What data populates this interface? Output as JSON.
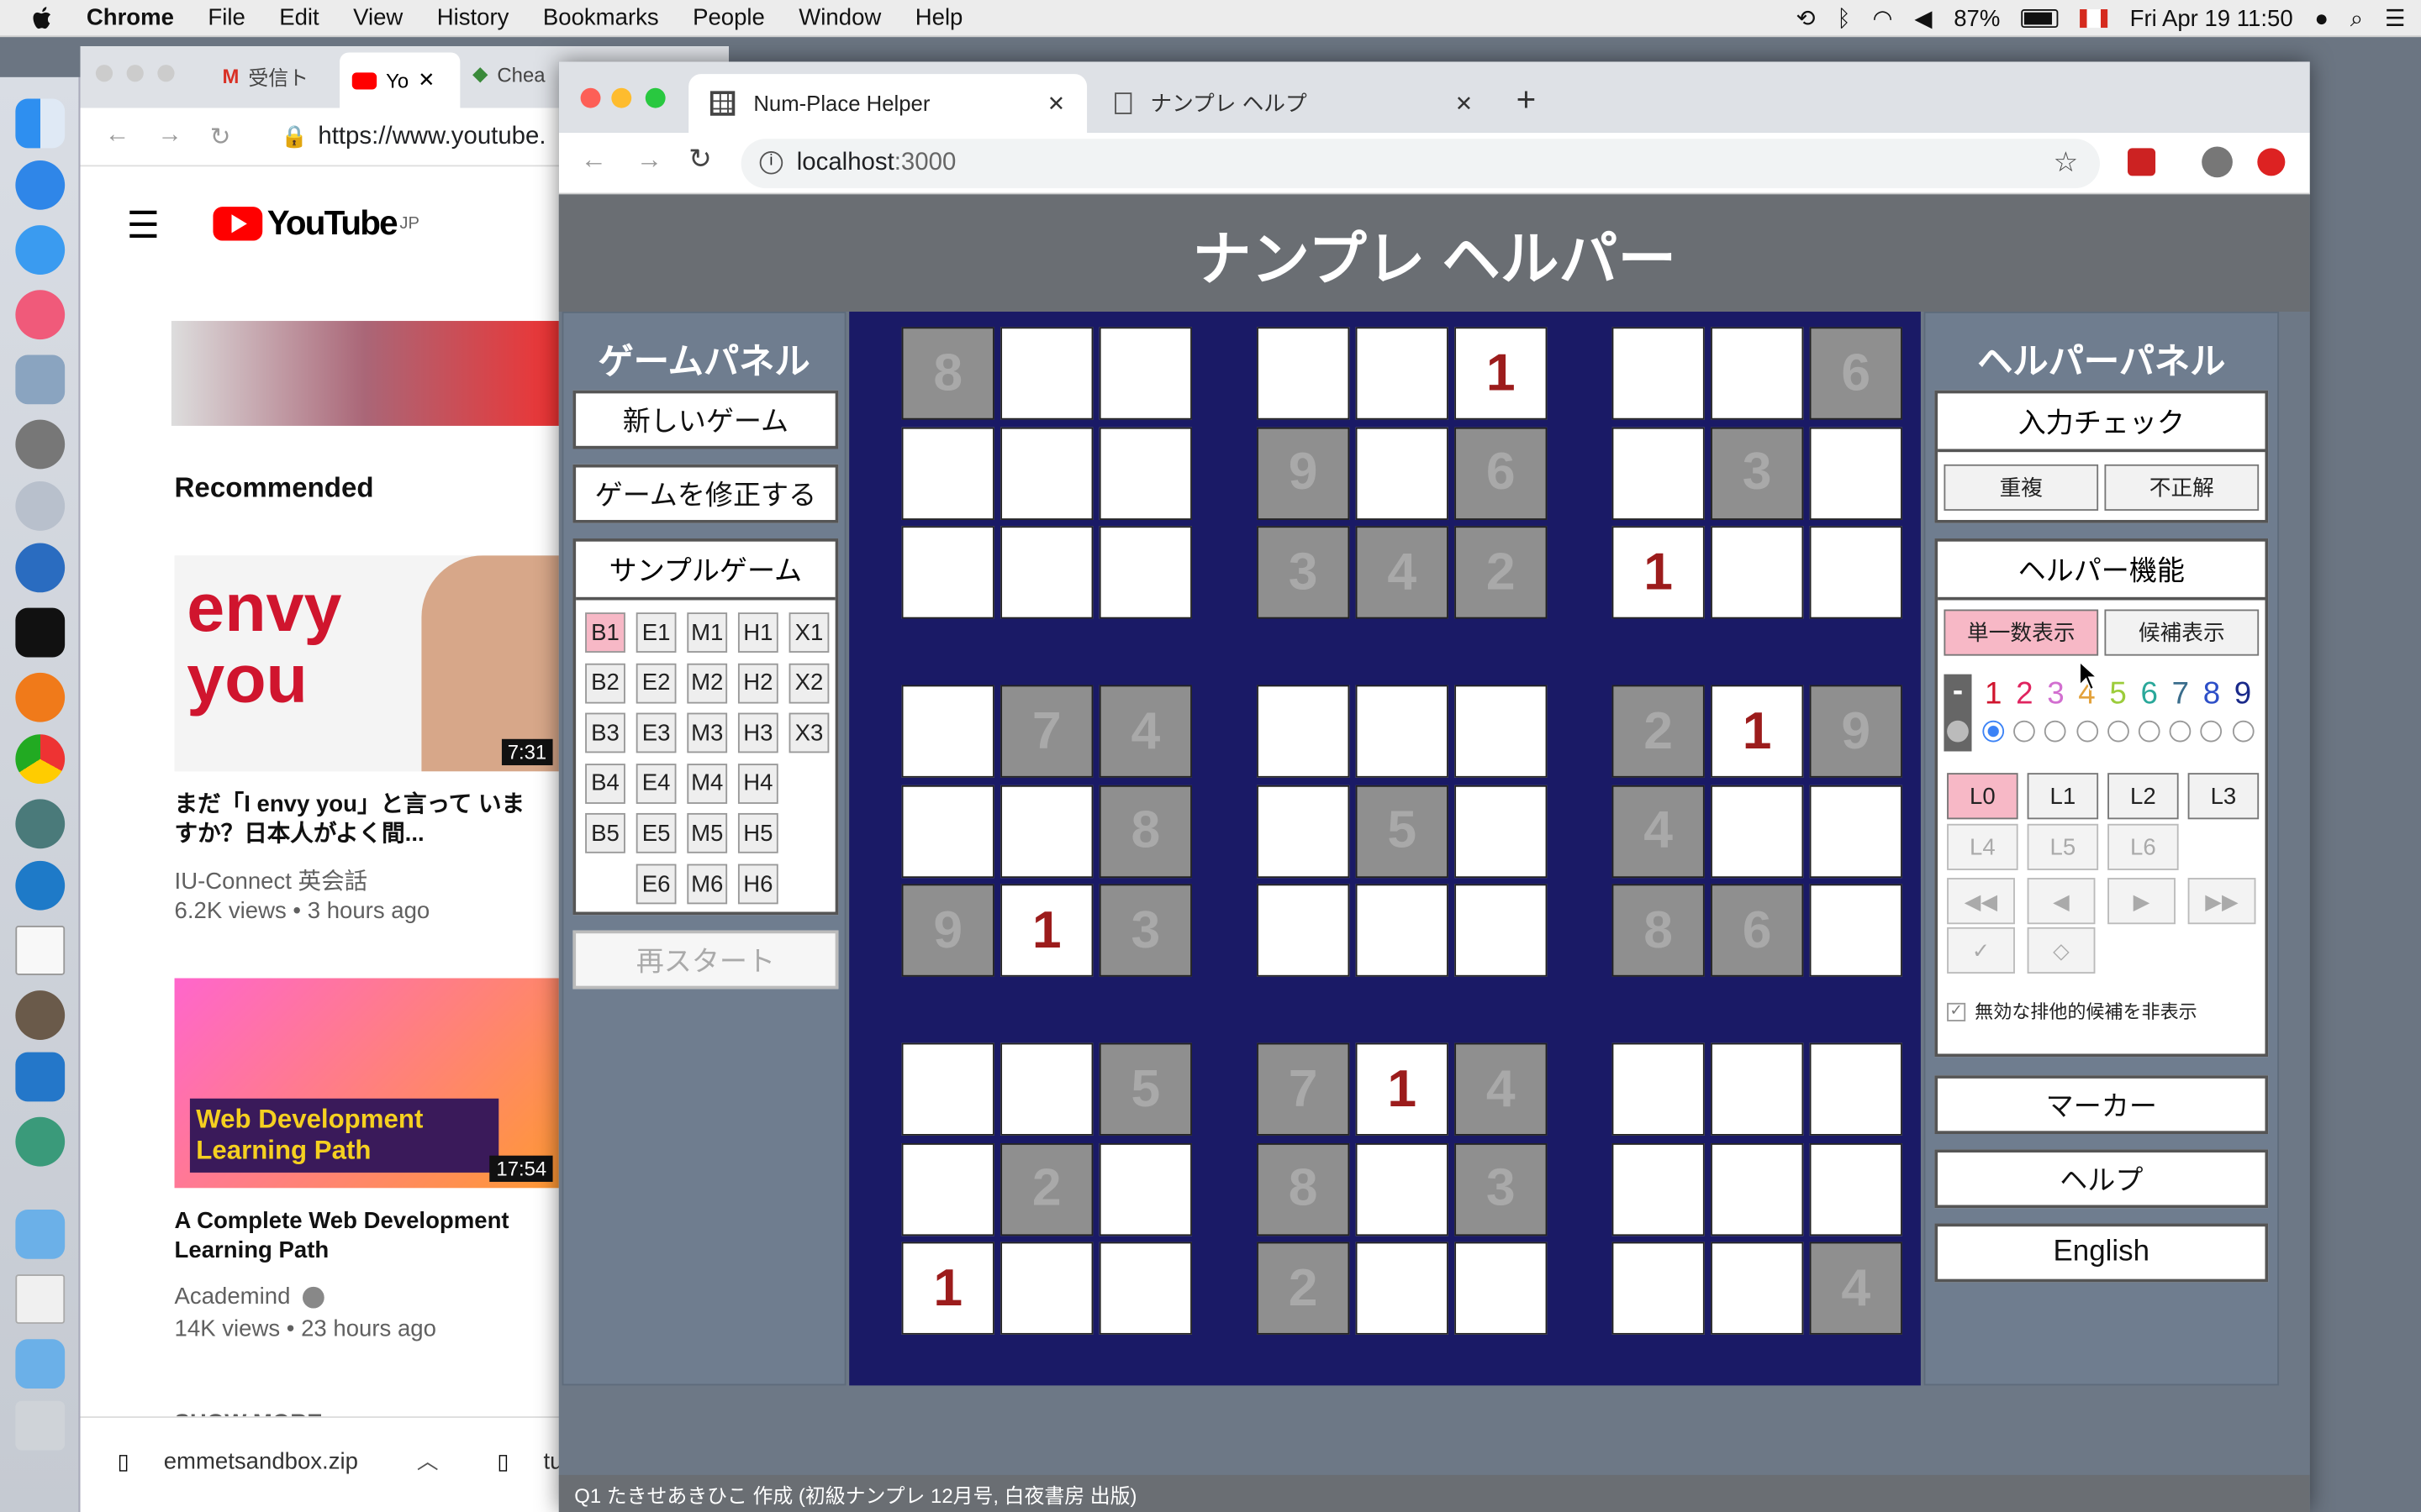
{
  "menubar": {
    "app": "Chrome",
    "items": [
      "File",
      "Edit",
      "View",
      "History",
      "Bookmarks",
      "People",
      "Window",
      "Help"
    ],
    "battery": "87%",
    "clock": "Fri Apr 19  11:50"
  },
  "bg_browser": {
    "tabs": [
      "受信ト",
      "Yo",
      "Chea"
    ],
    "url": "https://www.youtube.",
    "logo_text": "YouTube",
    "logo_sup": "JP",
    "recommended": "Recommended",
    "videos": [
      {
        "thumb_text": "envy you",
        "duration": "7:31",
        "title": "まだ「I envy you」と言って いますか？日本人がよく間...",
        "channel": "IU-Connect 英会話",
        "meta": "6.2K views • 3 hours ago"
      },
      {
        "thumb_text": "Web Development Learning Path",
        "duration": "17:54",
        "title": "A Complete Web Development Learning Path",
        "channel": "Academind",
        "meta": "14K views • 23 hours ago"
      }
    ],
    "show_more": "SHOW MORE",
    "download": "emmetsandbox.zip",
    "download2": "tu"
  },
  "browser": {
    "tabs": [
      {
        "title": "Num-Place Helper",
        "active": true
      },
      {
        "title": "ナンプレ ヘルプ",
        "active": false
      }
    ],
    "url_host": "localhost",
    "url_port": ":3000"
  },
  "app": {
    "title": "ナンプレ ヘルパー",
    "game_panel": {
      "heading": "ゲームパネル",
      "new_game": "新しいゲーム",
      "fix_game": "ゲームを修正する",
      "sample_heading": "サンプルゲーム",
      "samples": [
        [
          "B1",
          "E1",
          "M1",
          "H1",
          "X1"
        ],
        [
          "B2",
          "E2",
          "M2",
          "H2",
          "X2"
        ],
        [
          "B3",
          "E3",
          "M3",
          "H3",
          "X3"
        ],
        [
          "B4",
          "E4",
          "M4",
          "H4",
          ""
        ],
        [
          "B5",
          "E5",
          "M5",
          "H5",
          ""
        ],
        [
          "",
          "E6",
          "M6",
          "H6",
          ""
        ]
      ],
      "selected_sample": "B1",
      "restart": "再スタート"
    },
    "board": [
      [
        {
          "v": "8",
          "t": "g"
        },
        {
          "v": "",
          "t": ""
        },
        {
          "v": "",
          "t": ""
        },
        {
          "v": "",
          "t": ""
        },
        {
          "v": "",
          "t": ""
        },
        {
          "v": "1",
          "t": "r"
        },
        {
          "v": "",
          "t": ""
        },
        {
          "v": "",
          "t": ""
        },
        {
          "v": "6",
          "t": "g"
        }
      ],
      [
        {
          "v": "",
          "t": ""
        },
        {
          "v": "",
          "t": ""
        },
        {
          "v": "",
          "t": ""
        },
        {
          "v": "9",
          "t": "g"
        },
        {
          "v": "",
          "t": ""
        },
        {
          "v": "6",
          "t": "g"
        },
        {
          "v": "",
          "t": ""
        },
        {
          "v": "3",
          "t": "g"
        },
        {
          "v": "",
          "t": ""
        }
      ],
      [
        {
          "v": "",
          "t": ""
        },
        {
          "v": "",
          "t": ""
        },
        {
          "v": "",
          "t": ""
        },
        {
          "v": "3",
          "t": "g"
        },
        {
          "v": "4",
          "t": "g"
        },
        {
          "v": "2",
          "t": "g"
        },
        {
          "v": "1",
          "t": "r"
        },
        {
          "v": "",
          "t": ""
        },
        {
          "v": "",
          "t": ""
        }
      ],
      [
        {
          "v": "",
          "t": ""
        },
        {
          "v": "7",
          "t": "g"
        },
        {
          "v": "4",
          "t": "g"
        },
        {
          "v": "",
          "t": ""
        },
        {
          "v": "",
          "t": ""
        },
        {
          "v": "",
          "t": ""
        },
        {
          "v": "2",
          "t": "g"
        },
        {
          "v": "1",
          "t": "r"
        },
        {
          "v": "9",
          "t": "g"
        }
      ],
      [
        {
          "v": "",
          "t": ""
        },
        {
          "v": "",
          "t": ""
        },
        {
          "v": "8",
          "t": "g"
        },
        {
          "v": "",
          "t": ""
        },
        {
          "v": "5",
          "t": "g"
        },
        {
          "v": "",
          "t": ""
        },
        {
          "v": "4",
          "t": "g"
        },
        {
          "v": "",
          "t": ""
        },
        {
          "v": "",
          "t": ""
        }
      ],
      [
        {
          "v": "9",
          "t": "g"
        },
        {
          "v": "1",
          "t": "r"
        },
        {
          "v": "3",
          "t": "g"
        },
        {
          "v": "",
          "t": ""
        },
        {
          "v": "",
          "t": ""
        },
        {
          "v": "",
          "t": ""
        },
        {
          "v": "8",
          "t": "g"
        },
        {
          "v": "6",
          "t": "g"
        },
        {
          "v": "",
          "t": ""
        }
      ],
      [
        {
          "v": "",
          "t": ""
        },
        {
          "v": "",
          "t": ""
        },
        {
          "v": "5",
          "t": "g"
        },
        {
          "v": "7",
          "t": "g"
        },
        {
          "v": "1",
          "t": "r"
        },
        {
          "v": "4",
          "t": "g"
        },
        {
          "v": "",
          "t": ""
        },
        {
          "v": "",
          "t": ""
        },
        {
          "v": "",
          "t": ""
        }
      ],
      [
        {
          "v": "",
          "t": ""
        },
        {
          "v": "2",
          "t": "g"
        },
        {
          "v": "",
          "t": ""
        },
        {
          "v": "8",
          "t": "g"
        },
        {
          "v": "",
          "t": ""
        },
        {
          "v": "3",
          "t": "g"
        },
        {
          "v": "",
          "t": ""
        },
        {
          "v": "",
          "t": ""
        },
        {
          "v": "",
          "t": ""
        }
      ],
      [
        {
          "v": "1",
          "t": "r"
        },
        {
          "v": "",
          "t": ""
        },
        {
          "v": "",
          "t": ""
        },
        {
          "v": "2",
          "t": "g"
        },
        {
          "v": "",
          "t": ""
        },
        {
          "v": "",
          "t": ""
        },
        {
          "v": "",
          "t": ""
        },
        {
          "v": "",
          "t": ""
        },
        {
          "v": "4",
          "t": "g"
        }
      ]
    ],
    "helper_panel": {
      "heading": "ヘルパーパネル",
      "input_check": "入力チェック",
      "duplicate": "重複",
      "incorrect": "不正解",
      "helper_functions": "ヘルパー機能",
      "single_display": "単一数表示",
      "candidate_display": "候補表示",
      "digit_dash": "-",
      "digits": [
        {
          "d": "1",
          "c": "#d0152e"
        },
        {
          "d": "2",
          "c": "#e0245f"
        },
        {
          "d": "3",
          "c": "#d26fd0"
        },
        {
          "d": "4",
          "c": "#e3a23c"
        },
        {
          "d": "5",
          "c": "#9ccc3b"
        },
        {
          "d": "6",
          "c": "#2aa89a"
        },
        {
          "d": "7",
          "c": "#3a6d8c"
        },
        {
          "d": "8",
          "c": "#2d4fc8"
        },
        {
          "d": "9",
          "c": "#1a2a8a"
        }
      ],
      "levels": [
        "L0",
        "L1",
        "L2",
        "L3",
        "L4",
        "L5",
        "L6"
      ],
      "hide_invalid": "無効な排他的候補を非表示",
      "marker": "マーカー",
      "help": "ヘルプ",
      "english": "English"
    },
    "footer": "Q1 たきせあきひこ 作成 (初級ナンプレ 12月号, 白夜書房 出版)"
  }
}
